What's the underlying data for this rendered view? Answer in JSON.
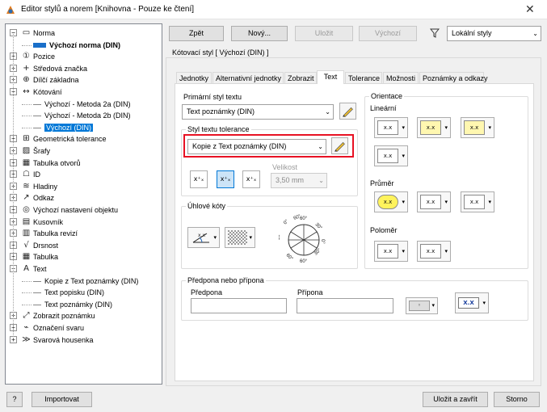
{
  "window": {
    "title": "Editor stylů a norem [Knihovna - Pouze ke čtení]"
  },
  "tree": [
    {
      "label": "Norma",
      "icon": "norm-icon"
    },
    {
      "label": "Výchozí norma (DIN)",
      "icon": "norm-item-icon",
      "bold": true
    },
    {
      "label": "Pozice",
      "icon": "balloon-icon"
    },
    {
      "label": "Středová značka",
      "icon": "center-mark-icon"
    },
    {
      "label": "Dílčí základna",
      "icon": "datum-target-icon"
    },
    {
      "label": "Kótování",
      "icon": "dimension-icon"
    },
    {
      "label": "Výchozí - Metoda 2a (DIN)",
      "icon": "style-item-icon"
    },
    {
      "label": "Výchozí - Metoda 2b (DIN)",
      "icon": "style-item-icon"
    },
    {
      "label": "Výchozí (DIN)",
      "icon": "style-item-icon",
      "selected": true
    },
    {
      "label": "Geometrická tolerance",
      "icon": "feature-control-frame-icon"
    },
    {
      "label": "Šrafy",
      "icon": "hatch-icon"
    },
    {
      "label": "Tabulka otvorů",
      "icon": "hole-table-icon"
    },
    {
      "label": "ID",
      "icon": "id-icon"
    },
    {
      "label": "Hladiny",
      "icon": "layers-icon"
    },
    {
      "label": "Odkaz",
      "icon": "leader-icon"
    },
    {
      "label": "Výchozí nastavení objektu",
      "icon": "object-defaults-icon"
    },
    {
      "label": "Kusovník",
      "icon": "parts-list-icon"
    },
    {
      "label": "Tabulka revizí",
      "icon": "revision-table-icon"
    },
    {
      "label": "Drsnost",
      "icon": "surface-texture-icon"
    },
    {
      "label": "Tabulka",
      "icon": "table-icon"
    },
    {
      "label": "Text",
      "icon": "text-icon"
    },
    {
      "label": "Kopie z Text poznámky (DIN)",
      "icon": "style-item-icon"
    },
    {
      "label": "Text popisku (DIN)",
      "icon": "style-item-icon"
    },
    {
      "label": "Text poznámky (DIN)",
      "icon": "style-item-icon"
    },
    {
      "label": "Zobrazit poznámku",
      "icon": "show-note-icon"
    },
    {
      "label": "Označení svaru",
      "icon": "weld-symbol-icon"
    },
    {
      "label": "Svarová housenka",
      "icon": "weld-bead-icon"
    }
  ],
  "toolbar": {
    "back": "Zpět",
    "new": "Nový...",
    "save": "Uložit",
    "default": "Výchozí",
    "filter_value": "Lokální styly"
  },
  "style_header": "Kótovací styl [ Výchozí (DIN) ]",
  "tabs": [
    "Jednotky",
    "Alternativní jednotky",
    "Zobrazit",
    "Text",
    "Tolerance",
    "Možnosti",
    "Poznámky a odkazy"
  ],
  "text_tab": {
    "primary_label": "Primární styl textu",
    "primary_value": "Text poznámky (DIN)",
    "tol_group": "Styl textu tolerance",
    "tol_value": "Kopie z Text poznámky (DIN)",
    "size_label": "Velikost",
    "size_value": "3,50 mm",
    "angular_group": "Úhlové kóty",
    "angle_labels": [
      "60°",
      "30°",
      "0°",
      "30°",
      "60°",
      "60°",
      "30°",
      "0°",
      "60°"
    ],
    "orient_group": "Orientace",
    "linear_label": "Lineární",
    "diameter_label": "Průměr",
    "radius_label": "Poloměr",
    "prefix_group": "Předpona nebo přípona",
    "prefix_label": "Předpona",
    "suffix_label": "Přípona",
    "tol_icons": [
      "x⁺ₓ",
      "x⁺ₓ",
      "x⁺ₓ"
    ],
    "lin_icons": [
      "x.x",
      "x.x",
      "x.x",
      "x.x"
    ],
    "dia_icons": [
      "x.x",
      "x.x",
      "x.x"
    ],
    "rad_icons": [
      "x.x",
      "x.x"
    ],
    "xx_icon": "X.X"
  },
  "footer": {
    "help": "?",
    "import": "Importovat",
    "save_close": "Uložit a zavřít",
    "cancel": "Storno"
  },
  "highlight_color": "#e81123"
}
